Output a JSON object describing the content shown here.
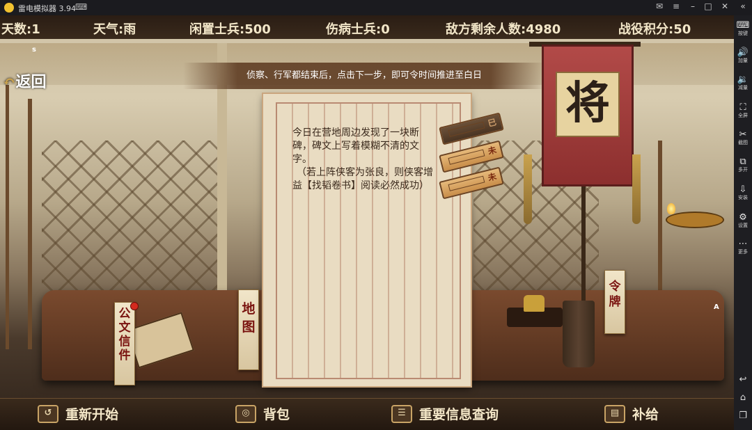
{
  "emulator": {
    "title": "雷电模拟器 3.94",
    "sidebar": [
      {
        "icon": "keyboard-icon",
        "label": "按键"
      },
      {
        "icon": "volume-up-icon",
        "label": "加量"
      },
      {
        "icon": "volume-down-icon",
        "label": "减量"
      },
      {
        "icon": "fullscreen-icon",
        "label": "全屏"
      },
      {
        "icon": "scissors-icon",
        "label": "截图"
      },
      {
        "icon": "multi-open-icon",
        "label": "多开"
      },
      {
        "icon": "apk-install-icon",
        "label": "安装"
      },
      {
        "icon": "gear-icon",
        "label": "设置"
      },
      {
        "icon": "more-icon",
        "label": "更多"
      }
    ]
  },
  "hud": {
    "day": "天数:1",
    "weather": "天气:雨",
    "idle_soldiers": "闲置士兵:500",
    "wounded_soldiers": "伤病士兵:0",
    "enemies_remaining": "敌方剩余人数:4980",
    "battle_points": "战役积分:50"
  },
  "back_label": "返回",
  "marker_s": "s",
  "marker_a": "A",
  "hint": "侦察、行军都结束后，点击下一步，即可令时间推进至白日",
  "letter": {
    "para1": "今日在营地周边发现了一块断碑，碑文上写着模糊不清的文字。",
    "para2": "（若上阵侠客为张良，则侠客增益【找韬卷书】阅读必然成功）"
  },
  "slips": [
    {
      "tag": "巳"
    },
    {
      "tag": "未"
    },
    {
      "tag": "未"
    }
  ],
  "banner_char": "将",
  "scrolls": {
    "documents": "公文信件",
    "map": "地图",
    "token": "令牌"
  },
  "bottom_menu": {
    "restart": "重新开始",
    "backpack": "背包",
    "info_query": "重要信息查询",
    "supply": "补给"
  },
  "colors": {
    "hud_text": "#f2e6c8",
    "banner_red": "#b24a48",
    "badge_red": "#d42a1e",
    "gold": "#c9a24e"
  }
}
